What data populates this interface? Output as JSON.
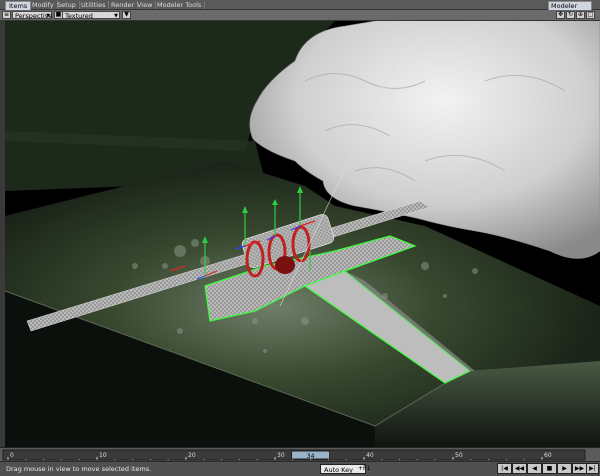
{
  "tabs": [
    {
      "label": "Items",
      "active": true
    },
    {
      "label": "Modify",
      "active": false
    },
    {
      "label": "Setup",
      "active": false
    },
    {
      "label": "Utilities",
      "active": false
    },
    {
      "label": "Render",
      "active": false
    },
    {
      "label": "View",
      "active": false
    },
    {
      "label": "Modeler Tools",
      "active": false
    }
  ],
  "top_right_dropdown": "Modeler",
  "viewport": {
    "view_mode": "Perspective",
    "shading_mode": "Textured Shaded Solid",
    "icons": [
      "move-icon",
      "rotate-icon",
      "zoom-icon",
      "maximize-icon"
    ]
  },
  "timeline": {
    "ticks": [
      "0",
      "10",
      "20",
      "30",
      "40",
      "50",
      "60"
    ],
    "current_frame": "34",
    "end_frame": "60"
  },
  "statusbar": {
    "message": "Drag mouse in view to move selected items.",
    "autokey_label": "Auto Key",
    "autokey_suffix": "+F1",
    "playback_icons": [
      "first-frame-icon",
      "prev-key-icon",
      "play-back-icon",
      "stop-icon",
      "play-forward-icon",
      "next-key-icon",
      "last-frame-icon"
    ]
  },
  "colors": {
    "terrain": "#2c3a28",
    "selection": "#3cff3c",
    "cloud": "#d8d8d8",
    "ring": "#c02020"
  }
}
